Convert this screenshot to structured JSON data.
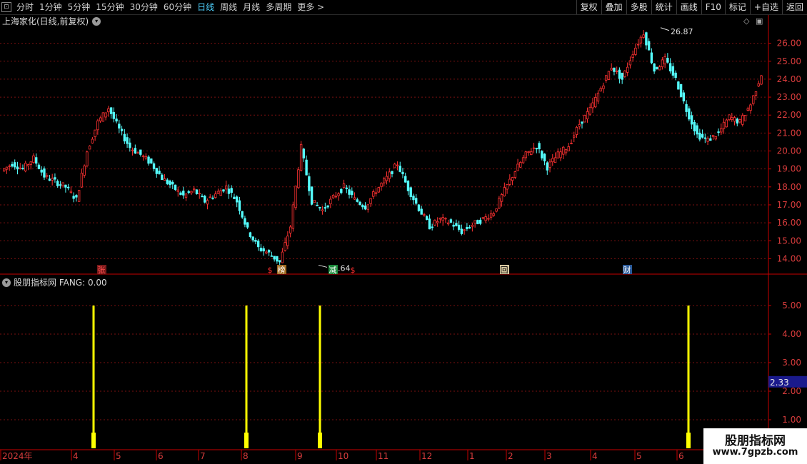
{
  "toolbar": {
    "periods": [
      "分时",
      "1分钟",
      "5分钟",
      "15分钟",
      "30分钟",
      "60分钟",
      "日线",
      "周线",
      "月线",
      "多周期",
      "更多 >"
    ],
    "active_period": "日线",
    "buttons": [
      "复权",
      "叠加",
      "多股",
      "统计",
      "画线",
      "F10",
      "标记",
      "+自选",
      "返回"
    ]
  },
  "main_title": "上海家化(日线,前复权)",
  "indicator_title": "股朋指标网 FANG: 0.00",
  "watermark": {
    "line1": "股朋指标网",
    "line2": "www.7gpzb.com"
  },
  "colors": {
    "up": "#ff3232",
    "down": "#54fcfc",
    "grid": "#7a1010",
    "signal": "#ffff00",
    "axis": "#c80000"
  },
  "chart_data": [
    {
      "type": "candlestick",
      "title": "上海家化(日线,前复权)",
      "y_ticks": [
        14.0,
        15.0,
        16.0,
        17.0,
        18.0,
        19.0,
        20.0,
        21.0,
        22.0,
        23.0,
        24.0,
        25.0,
        26.0
      ],
      "ylim": [
        13.3,
        26.9
      ],
      "annotations": [
        {
          "label": "26.87",
          "value": 26.87,
          "position": "high"
        },
        {
          "label": "13.64",
          "value": 13.64,
          "position": "low"
        }
      ],
      "event_markers": [
        {
          "label": "张",
          "month": "4"
        },
        {
          "label": "$",
          "month": "8"
        },
        {
          "label": "榜",
          "month": "8"
        },
        {
          "label": "减",
          "month": "9"
        },
        {
          "label": "$",
          "month": "10"
        },
        {
          "label": "回",
          "month": "2"
        },
        {
          "label": "财",
          "month": "4"
        }
      ],
      "close_path": [
        {
          "month": "2024年",
          "close": 18.9
        },
        {
          "month": "2024年",
          "close": 19.3
        },
        {
          "month": "2024年",
          "close": 19.0
        },
        {
          "month": "2024年",
          "close": 19.6
        },
        {
          "month": "4",
          "close": 18.6
        },
        {
          "month": "4",
          "close": 18.3
        },
        {
          "month": "4",
          "close": 18.0
        },
        {
          "month": "4",
          "close": 17.3
        },
        {
          "month": "5",
          "close": 20.0
        },
        {
          "month": "5",
          "close": 21.6
        },
        {
          "month": "5",
          "close": 22.4
        },
        {
          "month": "5",
          "close": 21.2
        },
        {
          "month": "6",
          "close": 20.2
        },
        {
          "month": "6",
          "close": 19.8
        },
        {
          "month": "6",
          "close": 19.3
        },
        {
          "month": "6",
          "close": 18.5
        },
        {
          "month": "7",
          "close": 18.0
        },
        {
          "month": "7",
          "close": 17.5
        },
        {
          "month": "7",
          "close": 17.8
        },
        {
          "month": "7",
          "close": 17.2
        },
        {
          "month": "8",
          "close": 17.6
        },
        {
          "month": "8",
          "close": 18.0
        },
        {
          "month": "8",
          "close": 17.2
        },
        {
          "month": "8",
          "close": 15.6
        },
        {
          "month": "9",
          "close": 14.6
        },
        {
          "month": "9",
          "close": 14.3
        },
        {
          "month": "9",
          "close": 13.8
        },
        {
          "month": "9",
          "close": 15.8
        },
        {
          "month": "10",
          "close": 20.2
        },
        {
          "month": "10",
          "close": 17.2
        },
        {
          "month": "10",
          "close": 16.7
        },
        {
          "month": "10",
          "close": 17.4
        },
        {
          "month": "11",
          "close": 18.0
        },
        {
          "month": "11",
          "close": 17.3
        },
        {
          "month": "11",
          "close": 16.9
        },
        {
          "month": "11",
          "close": 17.8
        },
        {
          "month": "12",
          "close": 18.5
        },
        {
          "month": "12",
          "close": 19.3
        },
        {
          "month": "12",
          "close": 17.9
        },
        {
          "month": "12",
          "close": 16.8
        },
        {
          "month": "1",
          "close": 15.8
        },
        {
          "month": "1",
          "close": 16.2
        },
        {
          "month": "1",
          "close": 16.0
        },
        {
          "month": "1",
          "close": 15.5
        },
        {
          "month": "2",
          "close": 15.9
        },
        {
          "month": "2",
          "close": 16.2
        },
        {
          "month": "2",
          "close": 16.6
        },
        {
          "month": "2",
          "close": 17.8
        },
        {
          "month": "3",
          "close": 18.9
        },
        {
          "month": "3",
          "close": 19.8
        },
        {
          "month": "3",
          "close": 20.3
        },
        {
          "month": "3",
          "close": 19.1
        },
        {
          "month": "4",
          "close": 19.8
        },
        {
          "month": "4",
          "close": 20.3
        },
        {
          "month": "4",
          "close": 21.5
        },
        {
          "month": "4",
          "close": 22.3
        },
        {
          "month": "5",
          "close": 23.5
        },
        {
          "month": "5",
          "close": 24.7
        },
        {
          "month": "5",
          "close": 24.0
        },
        {
          "month": "5",
          "close": 25.5
        },
        {
          "month": "6",
          "close": 26.6
        },
        {
          "month": "6",
          "close": 24.5
        },
        {
          "month": "6",
          "close": 25.1
        },
        {
          "month": "6",
          "close": 24.0
        },
        {
          "month": "6",
          "close": 22.3
        },
        {
          "month": "6",
          "close": 20.9
        },
        {
          "month": "6",
          "close": 20.6
        },
        {
          "month": "6",
          "close": 21.0
        },
        {
          "month": "6",
          "close": 21.9
        },
        {
          "month": "6",
          "close": 21.6
        },
        {
          "month": "6",
          "close": 22.6
        },
        {
          "month": "6",
          "close": 24.3
        }
      ],
      "x_ticks": [
        "2024年",
        "4",
        "5",
        "6",
        "7",
        "8",
        "9",
        "10",
        "11",
        "12",
        "1",
        "2",
        "3",
        "4",
        "5",
        "6"
      ]
    },
    {
      "type": "bar",
      "title": "股朋指标网 FANG: 0.00",
      "series_name": "FANG",
      "y_ticks": [
        1.0,
        2.0,
        3.0,
        4.0,
        5.0
      ],
      "ylim": [
        0,
        5.5
      ],
      "current_value_label": "2.33",
      "current_value": 2.33,
      "signals": [
        {
          "month": "4",
          "value": 5
        },
        {
          "month": "8",
          "value": 5
        },
        {
          "month": "9",
          "value": 5
        },
        {
          "month": "6",
          "value": 5
        }
      ]
    }
  ]
}
